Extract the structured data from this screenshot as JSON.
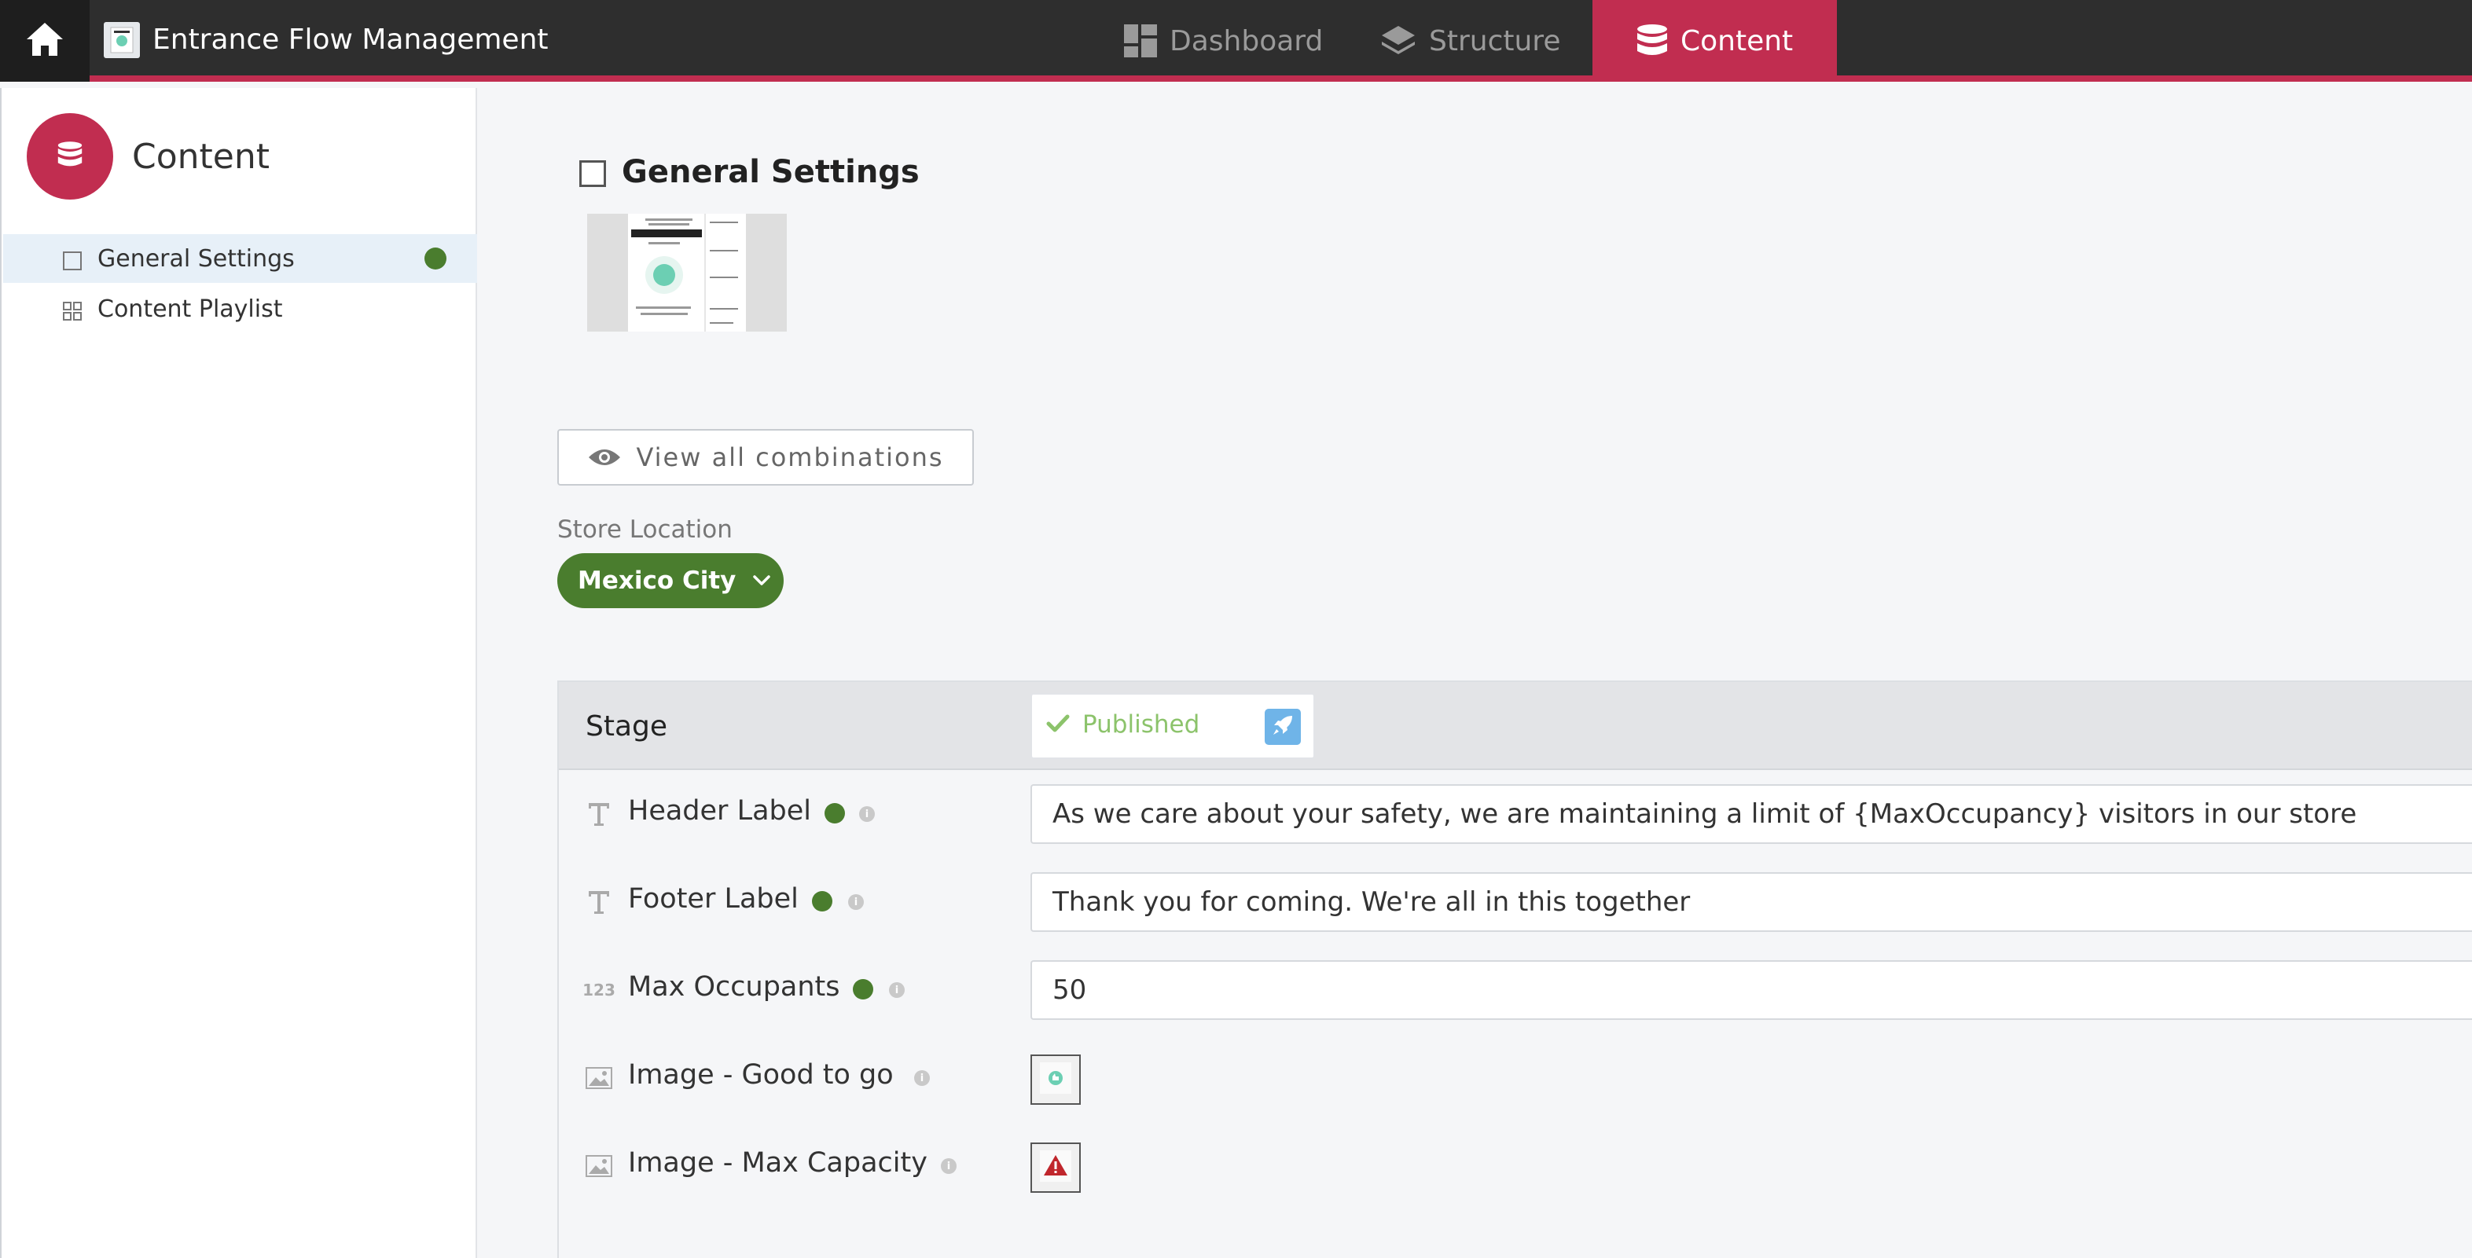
{
  "app": {
    "title": "Entrance Flow Management",
    "accent_color": "#c12d50",
    "home_icon": "home-icon",
    "app_icon": "app-thumbnail-icon"
  },
  "nav": {
    "tabs": [
      {
        "label": "Dashboard",
        "icon": "dashboard-icon",
        "active": false
      },
      {
        "label": "Structure",
        "icon": "layers-icon",
        "active": false
      },
      {
        "label": "Content",
        "icon": "database-icon",
        "active": true
      }
    ]
  },
  "sidebar": {
    "title": "Content",
    "logo_icon": "database-icon",
    "items": [
      {
        "label": "General Settings",
        "icon": "square-icon",
        "selected": true,
        "status_color": "#4a7d2e"
      },
      {
        "label": "Content Playlist",
        "icon": "grid-icon",
        "selected": false
      }
    ]
  },
  "main": {
    "section_title": "General Settings",
    "view_combinations_label": "View all combinations",
    "store_location": {
      "label": "Store Location",
      "value": "Mexico City",
      "color": "#4a7d2e"
    },
    "stage": {
      "label": "Stage",
      "status": "Published",
      "status_color": "#8cc36b",
      "publish_icon": "rocket-icon"
    },
    "fields": [
      {
        "label": "Header Label",
        "type_icon": "text-icon",
        "value": "As we care about your safety, we are maintaining a limit of {MaxOccupancy} visitors in our store",
        "has_status": true
      },
      {
        "label": "Footer Label",
        "type_icon": "text-icon",
        "value": "Thank you for coming. We're all in this together",
        "has_status": true
      },
      {
        "label": "Max Occupants",
        "type_icon": "number-icon",
        "type_icon_text": "123",
        "value": "50",
        "has_status": true
      },
      {
        "label": "Image - Good to go",
        "type_icon": "image-icon",
        "image_icon": "thumbs-up-icon",
        "has_status": false
      },
      {
        "label": "Image - Max Capacity",
        "type_icon": "image-icon",
        "image_icon": "warning-icon",
        "has_status": false
      }
    ]
  }
}
